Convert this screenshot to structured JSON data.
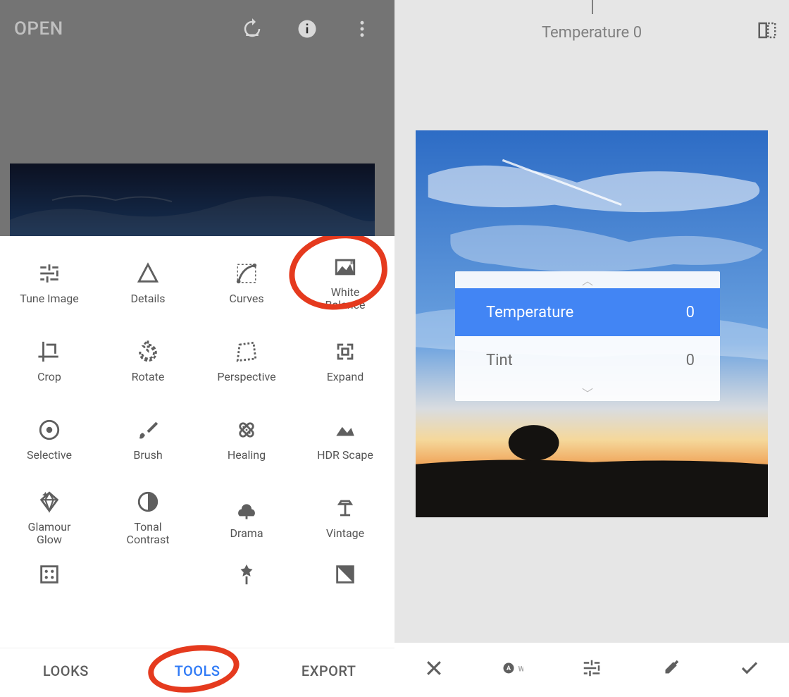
{
  "left": {
    "open_label": "OPEN",
    "tools_grid": [
      {
        "label": "Tune Image",
        "icon": "tune"
      },
      {
        "label": "Details",
        "icon": "details"
      },
      {
        "label": "Curves",
        "icon": "curves"
      },
      {
        "label": "White Balance",
        "icon": "wb"
      },
      {
        "label": "Crop",
        "icon": "crop"
      },
      {
        "label": "Rotate",
        "icon": "rotate"
      },
      {
        "label": "Perspective",
        "icon": "perspective"
      },
      {
        "label": "Expand",
        "icon": "expand"
      },
      {
        "label": "Selective",
        "icon": "selective"
      },
      {
        "label": "Brush",
        "icon": "brush"
      },
      {
        "label": "Healing",
        "icon": "healing"
      },
      {
        "label": "HDR Scape",
        "icon": "hdr"
      },
      {
        "label": "Glamour Glow",
        "icon": "glamour"
      },
      {
        "label": "Tonal Contrast",
        "icon": "tonal"
      },
      {
        "label": "Drama",
        "icon": "drama"
      },
      {
        "label": "Vintage",
        "icon": "vintage"
      },
      {
        "label": "",
        "icon": "frames"
      },
      {
        "label": "",
        "icon": "retro"
      },
      {
        "label": "",
        "icon": "grunge"
      },
      {
        "label": "",
        "icon": "bw"
      }
    ],
    "tabs": {
      "looks": "LOOKS",
      "tools": "TOOLS",
      "export": "EXPORT"
    }
  },
  "right": {
    "readout_param": "Temperature",
    "readout_value": "0",
    "sliders": [
      {
        "name": "Temperature",
        "value": "0",
        "selected": true
      },
      {
        "name": "Tint",
        "value": "0",
        "selected": false
      }
    ],
    "aw_label": "AW"
  },
  "annotation_color": "#e53a1e"
}
